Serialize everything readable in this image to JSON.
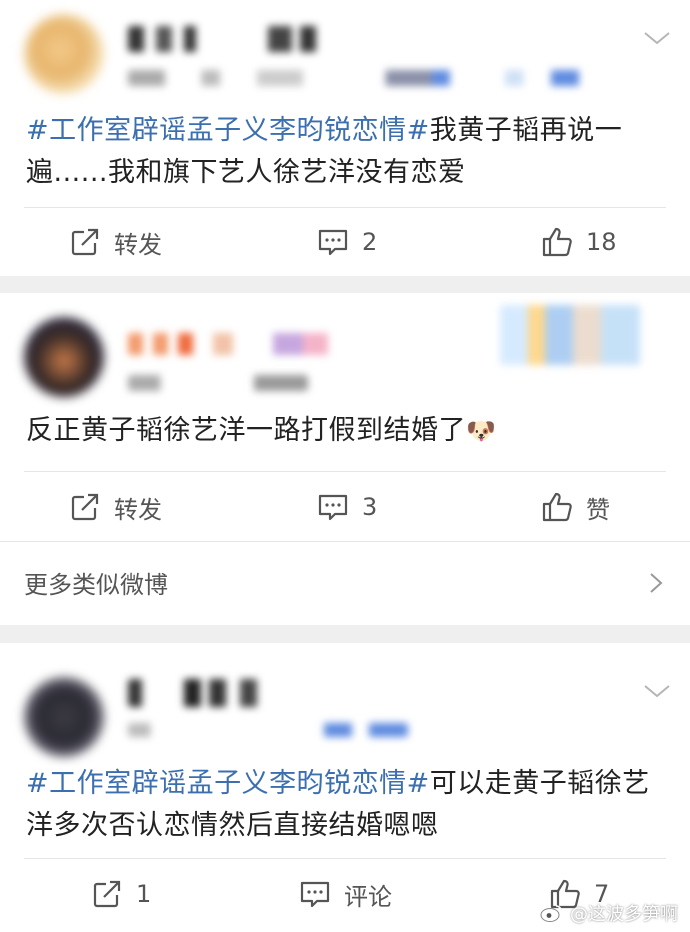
{
  "posts": [
    {
      "text_tag": "#工作室辟谣孟子义李昀锐恋情#",
      "text_body": "我黄子韬再说一遍......我和旗下艺人徐艺洋没有恋爱",
      "actions": {
        "repost": "转发",
        "comment": "2",
        "like": "18"
      }
    },
    {
      "text_body": "反正黄子韬徐艺洋一路打假到结婚了",
      "emoji": "🐶",
      "actions": {
        "repost": "转发",
        "comment": "3",
        "like": "赞"
      }
    },
    {
      "text_tag": "#工作室辟谣孟子义李昀锐恋情#",
      "text_body": "可以走黄子韬徐艺洋多次否认恋情然后直接结婚嗯嗯",
      "actions": {
        "repost": "1",
        "comment": "评论",
        "like": "7"
      }
    }
  ],
  "more_similar": "更多类似微博",
  "watermark": "@这波多笋啊",
  "colors": {
    "hashtag": "#3b6fb0",
    "text": "#222222",
    "action_text": "#555555",
    "background": "#efefef"
  }
}
